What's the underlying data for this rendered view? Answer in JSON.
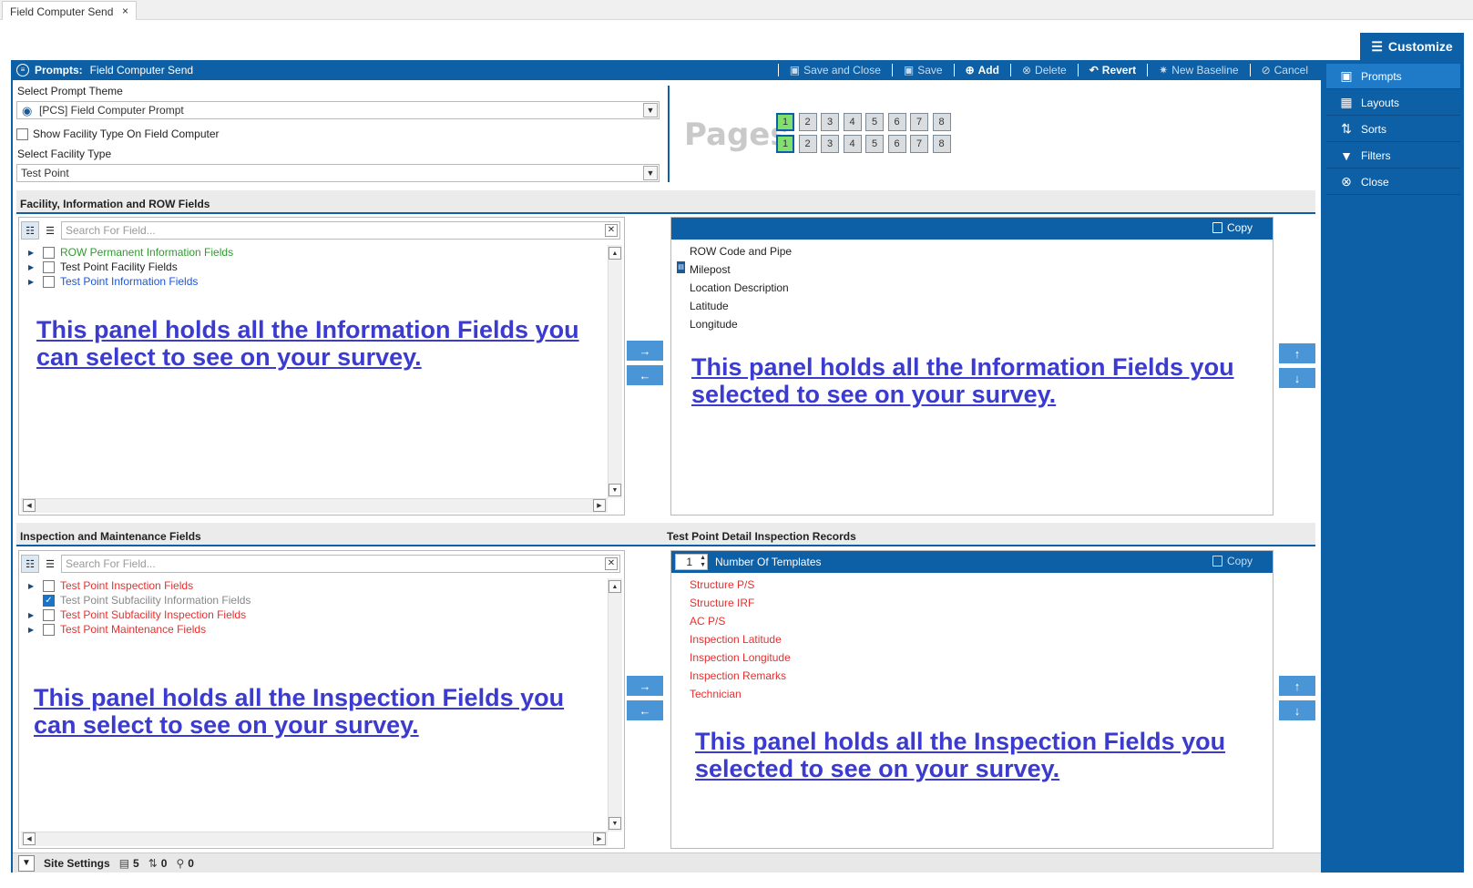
{
  "tab": {
    "title": "Field Computer Send",
    "close": "×"
  },
  "customize": {
    "label": "Customize",
    "icon": "sliders-icon"
  },
  "header": {
    "label": "Prompts:",
    "title": "Field Computer Send",
    "toolbar": {
      "save_close": "Save and Close",
      "save": "Save",
      "add": "Add",
      "delete": "Delete",
      "revert": "Revert",
      "new_baseline": "New Baseline",
      "cancel": "Cancel"
    }
  },
  "side": {
    "items": [
      {
        "label": "Prompts",
        "icon": "prompt-icon"
      },
      {
        "label": "Layouts",
        "icon": "grid-icon"
      },
      {
        "label": "Sorts",
        "icon": "sort-icon"
      },
      {
        "label": "Filters",
        "icon": "filter-icon"
      },
      {
        "label": "Close",
        "icon": "close-circle-icon"
      }
    ]
  },
  "theme": {
    "label": "Select Prompt Theme",
    "value": "[PCS] Field Computer Prompt",
    "show_facility": "Show Facility Type On Field Computer",
    "facility_label": "Select Facility Type",
    "facility_value": "Test Point"
  },
  "pages": {
    "label": "Pages",
    "row1": [
      "1",
      "2",
      "3",
      "4",
      "5",
      "6",
      "7",
      "8"
    ],
    "row2": [
      "1",
      "2",
      "3",
      "4",
      "5",
      "6",
      "7",
      "8"
    ],
    "active": 1
  },
  "section1": {
    "title": "Facility, Information and ROW Fields",
    "search_placeholder": "Search For Field...",
    "tree": [
      {
        "label": "ROW Permanent Information Fields",
        "color": "#2f9a2f",
        "checked": false
      },
      {
        "label": "Test Point Facility Fields",
        "color": "#222222",
        "checked": false
      },
      {
        "label": "Test Point Information Fields",
        "color": "#1a56d9",
        "checked": false
      }
    ],
    "annot_left": [
      "This panel holds all the Information Fields you",
      "can select to see on your survey."
    ],
    "copy": "Copy",
    "selected": [
      "ROW Code and Pipe",
      "Milepost",
      "Location Description",
      "Latitude",
      "Longitude"
    ],
    "annot_right": [
      "This panel holds all the Information Fields you",
      "selected to see on your survey."
    ]
  },
  "section2": {
    "title": "Inspection and Maintenance Fields",
    "title_right": "Test Point Detail Inspection Records",
    "search_placeholder": "Search For Field...",
    "tree": [
      {
        "label": "Test Point Inspection Fields",
        "color": "#e33131",
        "checked": false
      },
      {
        "label": "Test Point Subfacility Information Fields",
        "color": "#888888",
        "checked": true
      },
      {
        "label": "Test Point Subfacility Inspection Fields",
        "color": "#e33131",
        "checked": false
      },
      {
        "label": "Test Point Maintenance Fields",
        "color": "#e33131",
        "checked": false
      }
    ],
    "annot_left": [
      "This panel holds all the Inspection Fields you",
      "can select to see on your survey."
    ],
    "templates_count": "1",
    "templates_label": "Number Of Templates",
    "copy": "Copy",
    "selected": [
      "Structure P/S",
      "Structure IRF",
      "AC P/S",
      "Inspection Latitude",
      "Inspection Longitude",
      "Inspection Remarks",
      "Technician"
    ],
    "annot_right": [
      "This panel holds all the Inspection Fields you",
      "selected to see on your survey."
    ]
  },
  "status": {
    "label": "Site Settings",
    "count1": "5",
    "count2": "0",
    "count3": "0"
  }
}
